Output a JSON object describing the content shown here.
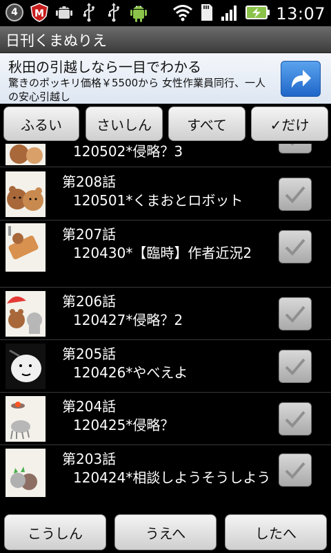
{
  "status_bar": {
    "notification_count": "4",
    "time": "13:07",
    "left_icons": [
      "notification-count-icon",
      "mcafee-icon",
      "android-debug-icon",
      "usb-icon",
      "usb-icon",
      "android-icon"
    ],
    "right_icons": [
      "wifi-icon",
      "sd-card-icon",
      "signal-icon",
      "battery-charging-icon"
    ]
  },
  "app": {
    "title": "日刊くまぬりえ"
  },
  "ad": {
    "headline": "秋田の引越しなら一目でわかる",
    "body": "驚きのポッキリ価格￥5500から 女性作業員同行、一人の安心引越し",
    "icon": "share-arrow-icon"
  },
  "filters": [
    {
      "label": "ふるい"
    },
    {
      "label": "さいしん"
    },
    {
      "label": "すべて"
    },
    {
      "label": "✓だけ"
    }
  ],
  "episodes": [
    {
      "title": "",
      "subtitle": "120502*侵略？3",
      "checked": true
    },
    {
      "title": "第208話",
      "subtitle": "120501*くまおとロボット",
      "checked": true
    },
    {
      "title": "第207話",
      "subtitle": "120430*【臨時】作者近況2",
      "checked": true
    },
    {
      "title": "第206話",
      "subtitle": "120427*侵略？2",
      "checked": true
    },
    {
      "title": "第205話",
      "subtitle": "120426*やべえよ",
      "checked": true
    },
    {
      "title": "第204話",
      "subtitle": "120425*侵略？",
      "checked": true
    },
    {
      "title": "第203話",
      "subtitle": "120424*相談しようそうしよう",
      "checked": true
    }
  ],
  "bottom_buttons": [
    {
      "label": "こうしん"
    },
    {
      "label": "うえへ"
    },
    {
      "label": "したへ"
    }
  ],
  "colors": {
    "accent_ad_button": "#2f7fdc",
    "list_background": "#000000"
  }
}
